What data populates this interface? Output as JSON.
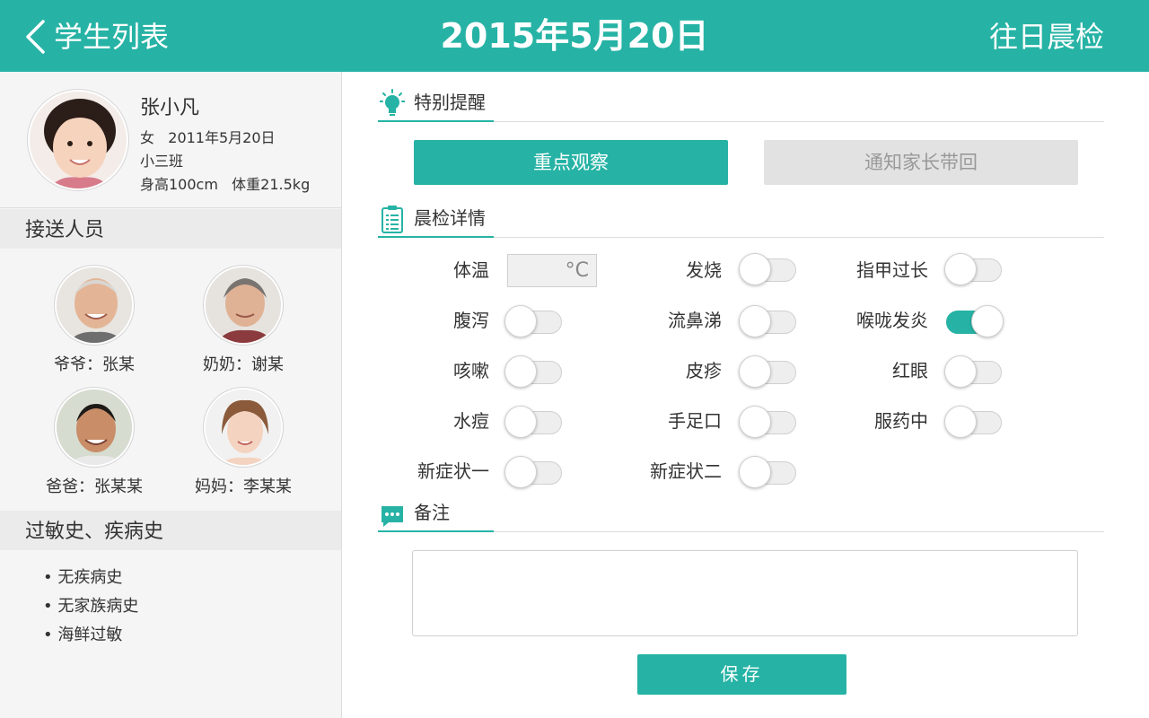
{
  "header": {
    "back_label": "学生列表",
    "title": "2015年5月20日",
    "history_label": "往日晨检"
  },
  "student": {
    "name": "张小凡",
    "gender_birth": "女   2011年5月20日",
    "class": "小三班",
    "height_weight": "身高100cm   体重21.5kg"
  },
  "pickup": {
    "title": "接送人员",
    "people": [
      {
        "label": "爷爷：张某"
      },
      {
        "label": "奶奶：谢某"
      },
      {
        "label": "爸爸：张某某"
      },
      {
        "label": "妈妈：李某某"
      }
    ]
  },
  "history": {
    "title": "过敏史、疾病史",
    "items": [
      "无疾病史",
      "无家族病史",
      "海鲜过敏"
    ]
  },
  "alerts": {
    "title": "特别提醒",
    "observe_label": "重点观察",
    "notify_label": "通知家长带回"
  },
  "check": {
    "title": "晨检详情",
    "temperature": {
      "label": "体温",
      "unit": "°C"
    },
    "items": [
      {
        "label": "发烧",
        "on": false
      },
      {
        "label": "指甲过长",
        "on": false
      },
      {
        "label": "腹泻",
        "on": false
      },
      {
        "label": "流鼻涕",
        "on": false
      },
      {
        "label": "喉咙发炎",
        "on": true
      },
      {
        "label": "咳嗽",
        "on": false
      },
      {
        "label": "皮疹",
        "on": false
      },
      {
        "label": "红眼",
        "on": false
      },
      {
        "label": "水痘",
        "on": false
      },
      {
        "label": "手足口",
        "on": false
      },
      {
        "label": "服药中",
        "on": false
      },
      {
        "label": "新症状一",
        "on": false
      },
      {
        "label": "新症状二",
        "on": false
      }
    ]
  },
  "notes": {
    "title": "备注",
    "value": ""
  },
  "save_label": "保存",
  "colors": {
    "accent": "#26b3a5",
    "panel_bg": "#f5f5f5",
    "disabled_button": "#e2e2e2"
  }
}
